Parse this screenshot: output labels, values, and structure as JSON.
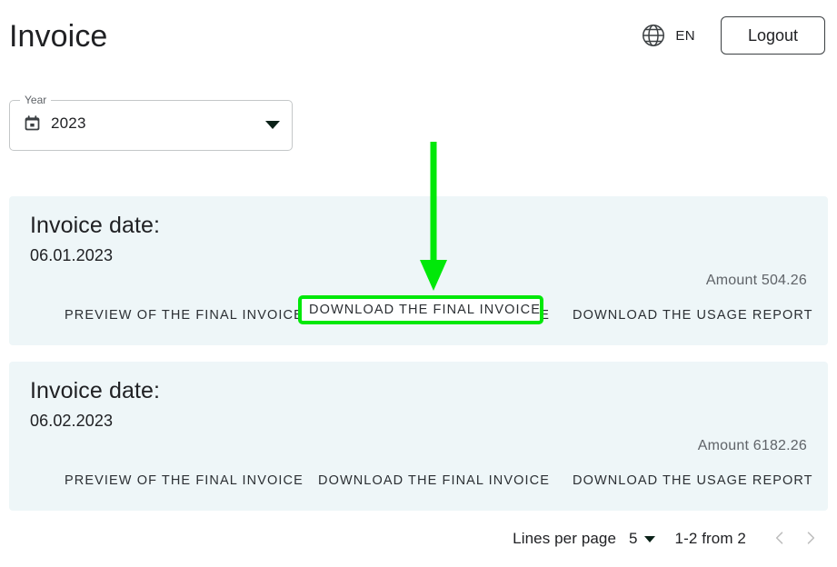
{
  "header": {
    "title": "Invoice",
    "language": {
      "icon": "globe-icon",
      "label": "EN"
    },
    "logout_label": "Logout"
  },
  "filters": {
    "year": {
      "legend": "Year",
      "value": "2023",
      "icon": "calendar-icon",
      "caret": "chevron-down-icon"
    }
  },
  "invoices": [
    {
      "title": "Invoice date:",
      "date": "06.01.2023",
      "amount": "Amount 504.26",
      "actions": {
        "preview": "PREVIEW OF THE FINAL INVOICE",
        "download_invoice": "DOWNLOAD THE FINAL INVOICE",
        "download_usage": "DOWNLOAD THE USAGE REPORT"
      }
    },
    {
      "title": "Invoice date:",
      "date": "06.02.2023",
      "amount": "Amount 6182.26",
      "actions": {
        "preview": "PREVIEW OF THE FINAL INVOICE",
        "download_invoice": "DOWNLOAD THE FINAL INVOICE",
        "download_usage": "DOWNLOAD THE USAGE REPORT"
      }
    }
  ],
  "pagination": {
    "lines_per_page_label": "Lines per page",
    "lines_per_page_value": "5",
    "range_label": "1-2 from 2",
    "prev_icon": "chevron-left-icon",
    "next_icon": "chevron-right-icon"
  },
  "annotation": {
    "color": "#00e809",
    "target_label": "DOWNLOAD THE FINAL INVOICE",
    "arrow_icon": "down-arrow-icon"
  },
  "colors": {
    "card_background": "#eef6f8",
    "page_background": "#ffffff",
    "text_primary": "#202124",
    "text_secondary": "#5f6368",
    "highlight": "#00e809"
  }
}
